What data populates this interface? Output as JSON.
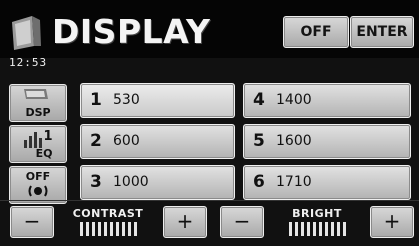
{
  "header": {
    "title": "DISPLAY",
    "clock": "12:53",
    "off_label": "OFF",
    "enter_label": "ENTER"
  },
  "side": {
    "dsp_label": "DSP",
    "eq_number": "1",
    "eq_label": "EQ",
    "off_label": "OFF"
  },
  "presets": [
    {
      "num": "1",
      "value": "530",
      "selected": true
    },
    {
      "num": "2",
      "value": "600"
    },
    {
      "num": "3",
      "value": "1000"
    },
    {
      "num": "4",
      "value": "1400"
    },
    {
      "num": "5",
      "value": "1600"
    },
    {
      "num": "6",
      "value": "1710"
    }
  ],
  "contrast": {
    "label": "CONTRAST",
    "minus": "−",
    "plus": "+",
    "level_segments": 10
  },
  "bright": {
    "label": "BRIGHT",
    "minus": "−",
    "plus": "+",
    "level_segments": 10
  },
  "colors": {
    "background": "#111111",
    "button": "#bdbdbd",
    "text": "#111111"
  }
}
